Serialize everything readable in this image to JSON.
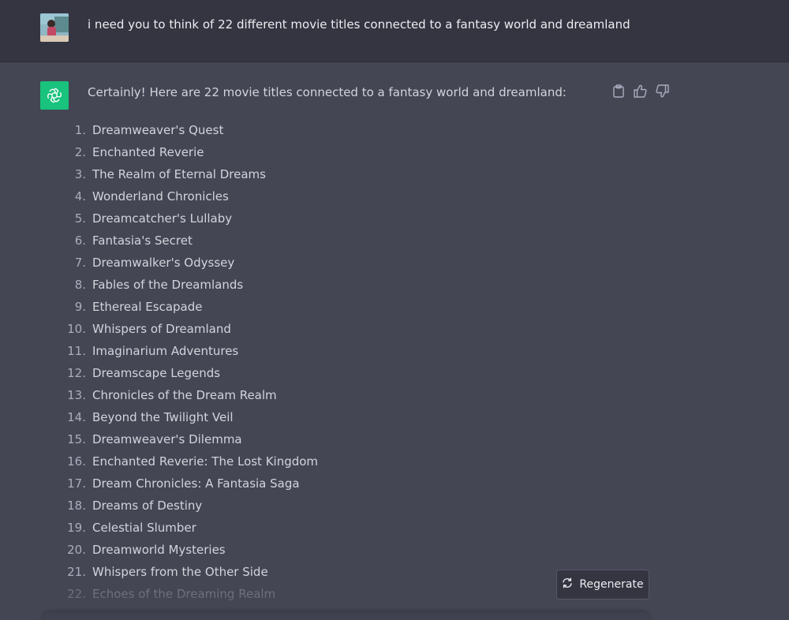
{
  "user_message": {
    "text": "i need you to think of 22 different movie titles connected to a fantasy world and dreamland",
    "avatar_icon": "user-photo-avatar"
  },
  "assistant_message": {
    "logo_icon": "openai-logo-icon",
    "accent_color": "#19c37d",
    "intro": "Certainly! Here are 22 movie titles connected to a fantasy world and dreamland:",
    "items": [
      {
        "num": "1.",
        "title": "Dreamweaver's Quest"
      },
      {
        "num": "2.",
        "title": "Enchanted Reverie"
      },
      {
        "num": "3.",
        "title": "The Realm of Eternal Dreams"
      },
      {
        "num": "4.",
        "title": "Wonderland Chronicles"
      },
      {
        "num": "5.",
        "title": "Dreamcatcher's Lullaby"
      },
      {
        "num": "6.",
        "title": "Fantasia's Secret"
      },
      {
        "num": "7.",
        "title": "Dreamwalker's Odyssey"
      },
      {
        "num": "8.",
        "title": "Fables of the Dreamlands"
      },
      {
        "num": "9.",
        "title": "Ethereal Escapade"
      },
      {
        "num": "10.",
        "title": "Whispers of Dreamland"
      },
      {
        "num": "11.",
        "title": "Imaginarium Adventures"
      },
      {
        "num": "12.",
        "title": "Dreamscape Legends"
      },
      {
        "num": "13.",
        "title": "Chronicles of the Dream Realm"
      },
      {
        "num": "14.",
        "title": "Beyond the Twilight Veil"
      },
      {
        "num": "15.",
        "title": "Dreamweaver's Dilemma"
      },
      {
        "num": "16.",
        "title": "Enchanted Reverie: The Lost Kingdom"
      },
      {
        "num": "17.",
        "title": "Dream Chronicles: A Fantasia Saga"
      },
      {
        "num": "18.",
        "title": "Dreams of Destiny"
      },
      {
        "num": "19.",
        "title": "Celestial Slumber"
      },
      {
        "num": "20.",
        "title": "Dreamworld Mysteries"
      },
      {
        "num": "21.",
        "title": "Whispers from the Other Side"
      },
      {
        "num": "22.",
        "title": "Echoes of the Dreaming Realm"
      }
    ]
  },
  "actions": {
    "copy_icon": "clipboard-icon",
    "like_icon": "thumbs-up-icon",
    "dislike_icon": "thumbs-down-icon"
  },
  "regenerate": {
    "label": "Regenerate",
    "icon": "refresh-icon"
  }
}
